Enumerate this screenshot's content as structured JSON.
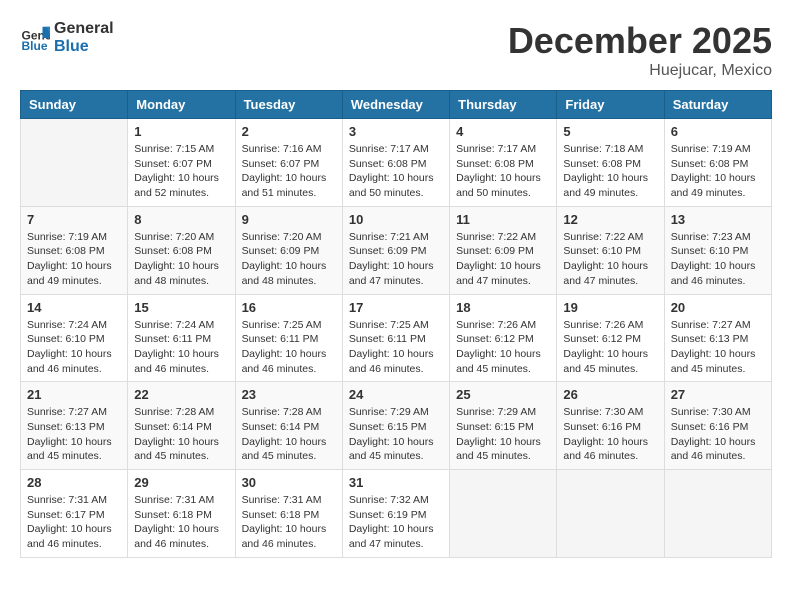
{
  "header": {
    "logo_general": "General",
    "logo_blue": "Blue",
    "month": "December 2025",
    "location": "Huejucar, Mexico"
  },
  "weekdays": [
    "Sunday",
    "Monday",
    "Tuesday",
    "Wednesday",
    "Thursday",
    "Friday",
    "Saturday"
  ],
  "weeks": [
    [
      {
        "day": "",
        "sunrise": "",
        "sunset": "",
        "daylight": ""
      },
      {
        "day": "1",
        "sunrise": "Sunrise: 7:15 AM",
        "sunset": "Sunset: 6:07 PM",
        "daylight": "Daylight: 10 hours and 52 minutes."
      },
      {
        "day": "2",
        "sunrise": "Sunrise: 7:16 AM",
        "sunset": "Sunset: 6:07 PM",
        "daylight": "Daylight: 10 hours and 51 minutes."
      },
      {
        "day": "3",
        "sunrise": "Sunrise: 7:17 AM",
        "sunset": "Sunset: 6:08 PM",
        "daylight": "Daylight: 10 hours and 50 minutes."
      },
      {
        "day": "4",
        "sunrise": "Sunrise: 7:17 AM",
        "sunset": "Sunset: 6:08 PM",
        "daylight": "Daylight: 10 hours and 50 minutes."
      },
      {
        "day": "5",
        "sunrise": "Sunrise: 7:18 AM",
        "sunset": "Sunset: 6:08 PM",
        "daylight": "Daylight: 10 hours and 49 minutes."
      },
      {
        "day": "6",
        "sunrise": "Sunrise: 7:19 AM",
        "sunset": "Sunset: 6:08 PM",
        "daylight": "Daylight: 10 hours and 49 minutes."
      }
    ],
    [
      {
        "day": "7",
        "sunrise": "Sunrise: 7:19 AM",
        "sunset": "Sunset: 6:08 PM",
        "daylight": "Daylight: 10 hours and 49 minutes."
      },
      {
        "day": "8",
        "sunrise": "Sunrise: 7:20 AM",
        "sunset": "Sunset: 6:08 PM",
        "daylight": "Daylight: 10 hours and 48 minutes."
      },
      {
        "day": "9",
        "sunrise": "Sunrise: 7:20 AM",
        "sunset": "Sunset: 6:09 PM",
        "daylight": "Daylight: 10 hours and 48 minutes."
      },
      {
        "day": "10",
        "sunrise": "Sunrise: 7:21 AM",
        "sunset": "Sunset: 6:09 PM",
        "daylight": "Daylight: 10 hours and 47 minutes."
      },
      {
        "day": "11",
        "sunrise": "Sunrise: 7:22 AM",
        "sunset": "Sunset: 6:09 PM",
        "daylight": "Daylight: 10 hours and 47 minutes."
      },
      {
        "day": "12",
        "sunrise": "Sunrise: 7:22 AM",
        "sunset": "Sunset: 6:10 PM",
        "daylight": "Daylight: 10 hours and 47 minutes."
      },
      {
        "day": "13",
        "sunrise": "Sunrise: 7:23 AM",
        "sunset": "Sunset: 6:10 PM",
        "daylight": "Daylight: 10 hours and 46 minutes."
      }
    ],
    [
      {
        "day": "14",
        "sunrise": "Sunrise: 7:24 AM",
        "sunset": "Sunset: 6:10 PM",
        "daylight": "Daylight: 10 hours and 46 minutes."
      },
      {
        "day": "15",
        "sunrise": "Sunrise: 7:24 AM",
        "sunset": "Sunset: 6:11 PM",
        "daylight": "Daylight: 10 hours and 46 minutes."
      },
      {
        "day": "16",
        "sunrise": "Sunrise: 7:25 AM",
        "sunset": "Sunset: 6:11 PM",
        "daylight": "Daylight: 10 hours and 46 minutes."
      },
      {
        "day": "17",
        "sunrise": "Sunrise: 7:25 AM",
        "sunset": "Sunset: 6:11 PM",
        "daylight": "Daylight: 10 hours and 46 minutes."
      },
      {
        "day": "18",
        "sunrise": "Sunrise: 7:26 AM",
        "sunset": "Sunset: 6:12 PM",
        "daylight": "Daylight: 10 hours and 45 minutes."
      },
      {
        "day": "19",
        "sunrise": "Sunrise: 7:26 AM",
        "sunset": "Sunset: 6:12 PM",
        "daylight": "Daylight: 10 hours and 45 minutes."
      },
      {
        "day": "20",
        "sunrise": "Sunrise: 7:27 AM",
        "sunset": "Sunset: 6:13 PM",
        "daylight": "Daylight: 10 hours and 45 minutes."
      }
    ],
    [
      {
        "day": "21",
        "sunrise": "Sunrise: 7:27 AM",
        "sunset": "Sunset: 6:13 PM",
        "daylight": "Daylight: 10 hours and 45 minutes."
      },
      {
        "day": "22",
        "sunrise": "Sunrise: 7:28 AM",
        "sunset": "Sunset: 6:14 PM",
        "daylight": "Daylight: 10 hours and 45 minutes."
      },
      {
        "day": "23",
        "sunrise": "Sunrise: 7:28 AM",
        "sunset": "Sunset: 6:14 PM",
        "daylight": "Daylight: 10 hours and 45 minutes."
      },
      {
        "day": "24",
        "sunrise": "Sunrise: 7:29 AM",
        "sunset": "Sunset: 6:15 PM",
        "daylight": "Daylight: 10 hours and 45 minutes."
      },
      {
        "day": "25",
        "sunrise": "Sunrise: 7:29 AM",
        "sunset": "Sunset: 6:15 PM",
        "daylight": "Daylight: 10 hours and 45 minutes."
      },
      {
        "day": "26",
        "sunrise": "Sunrise: 7:30 AM",
        "sunset": "Sunset: 6:16 PM",
        "daylight": "Daylight: 10 hours and 46 minutes."
      },
      {
        "day": "27",
        "sunrise": "Sunrise: 7:30 AM",
        "sunset": "Sunset: 6:16 PM",
        "daylight": "Daylight: 10 hours and 46 minutes."
      }
    ],
    [
      {
        "day": "28",
        "sunrise": "Sunrise: 7:31 AM",
        "sunset": "Sunset: 6:17 PM",
        "daylight": "Daylight: 10 hours and 46 minutes."
      },
      {
        "day": "29",
        "sunrise": "Sunrise: 7:31 AM",
        "sunset": "Sunset: 6:18 PM",
        "daylight": "Daylight: 10 hours and 46 minutes."
      },
      {
        "day": "30",
        "sunrise": "Sunrise: 7:31 AM",
        "sunset": "Sunset: 6:18 PM",
        "daylight": "Daylight: 10 hours and 46 minutes."
      },
      {
        "day": "31",
        "sunrise": "Sunrise: 7:32 AM",
        "sunset": "Sunset: 6:19 PM",
        "daylight": "Daylight: 10 hours and 47 minutes."
      },
      {
        "day": "",
        "sunrise": "",
        "sunset": "",
        "daylight": ""
      },
      {
        "day": "",
        "sunrise": "",
        "sunset": "",
        "daylight": ""
      },
      {
        "day": "",
        "sunrise": "",
        "sunset": "",
        "daylight": ""
      }
    ]
  ]
}
